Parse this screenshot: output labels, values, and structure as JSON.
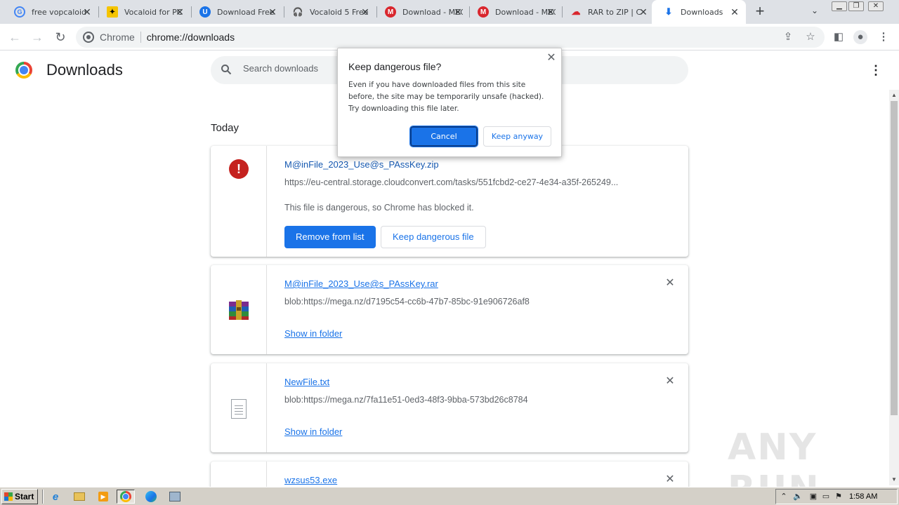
{
  "browser": {
    "tabs": [
      {
        "title": "free vopcaloid",
        "icon": "google-icon",
        "active": false
      },
      {
        "title": "Vocaloid for PC",
        "icon": "vocaloid-icon",
        "active": false
      },
      {
        "title": "Download Free",
        "icon": "shield-icon",
        "active": false
      },
      {
        "title": "Vocaloid 5 Free",
        "icon": "headphones-icon",
        "active": false
      },
      {
        "title": "Download - MEGA",
        "icon": "mega-icon",
        "active": false
      },
      {
        "title": "Download - MEGA",
        "icon": "mega-icon",
        "active": false
      },
      {
        "title": "RAR to ZIP | C",
        "icon": "cloudconvert-icon",
        "active": false
      },
      {
        "title": "Downloads",
        "icon": "download-icon",
        "active": true
      }
    ],
    "omnibox": {
      "chip": "Chrome",
      "url": "chrome://downloads"
    }
  },
  "page": {
    "title": "Downloads",
    "search_placeholder": "Search downloads",
    "section_label": "Today"
  },
  "downloads": [
    {
      "file_name": "M@inFile_2023_Use@s_PAssKey.zip",
      "url": "https://eu-central.storage.cloudconvert.com/tasks/551fcbd2-ce27-4e34-a35f-265249...",
      "status": "This file is dangerous, so Chrome has blocked it.",
      "remove_label": "Remove from list",
      "keep_label": "Keep dangerous file"
    },
    {
      "file_name": "M@inFile_2023_Use@s_PAssKey.rar",
      "url": "blob:https://mega.nz/d7195c54-cc6b-47b7-85bc-91e906726af8",
      "action_label": "Show in folder"
    },
    {
      "file_name": "NewFile.txt",
      "url": "blob:https://mega.nz/7fa11e51-0ed3-48f3-9bba-573bd26c8784",
      "action_label": "Show in folder"
    },
    {
      "file_name": "wzsus53.exe"
    }
  ],
  "dialog": {
    "title": "Keep dangerous file?",
    "body": "Even if you have downloaded files from this site before, the site may be temporarily unsafe (hacked). Try downloading this file later.",
    "cancel_label": "Cancel",
    "keep_label": "Keep anyway"
  },
  "taskbar": {
    "start_label": "Start",
    "clock": "1:58 AM"
  },
  "watermark": "ANY RUN",
  "colors": {
    "accent": "#1a73e8",
    "danger": "#c5221f",
    "tabstrip": "#dee1e6",
    "taskbar": "#d4d0c8"
  }
}
